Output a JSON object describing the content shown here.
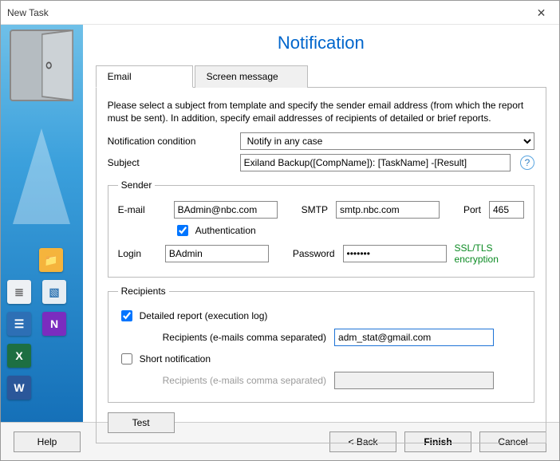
{
  "window": {
    "title": "New Task",
    "close_glyph": "✕"
  },
  "page": {
    "title": "Notification"
  },
  "tabs": {
    "email": "Email",
    "screen": "Screen message"
  },
  "desc": "Please select a subject from template and specify the sender email address (from which the report must be sent). In addition, specify email addresses of recipients of detailed or brief reports.",
  "condition": {
    "label": "Notification condition",
    "value": "Notify in any case"
  },
  "subject": {
    "label": "Subject",
    "value": "Exiland Backup([CompName]): [TaskName] -[Result]",
    "help_glyph": "?"
  },
  "sender": {
    "legend": "Sender",
    "email_label": "E-mail",
    "email_value": "BAdmin@nbc.com",
    "smtp_label": "SMTP",
    "smtp_value": "smtp.nbc.com",
    "port_label": "Port",
    "port_value": "465",
    "auth_label": "Authentication",
    "auth_checked": true,
    "login_label": "Login",
    "login_value": "BAdmin",
    "password_label": "Password",
    "password_value": "•••••••",
    "ssl_label": "SSL/TLS encryption"
  },
  "recipients": {
    "legend": "Recipients",
    "detailed_label": "Detailed report (execution log)",
    "detailed_checked": true,
    "recipients_label": "Recipients (e-mails comma separated)",
    "detailed_value": "adm_stat@gmail.com",
    "short_label": "Short notification",
    "short_checked": false,
    "short_value": ""
  },
  "buttons": {
    "test": "Test",
    "help": "Help",
    "back": "< Back",
    "finish": "Finish",
    "cancel": "Cancel"
  },
  "sidebar_icons": {
    "folder": "📁",
    "doc": "≣",
    "pic": "▧",
    "contacts": "☰",
    "onenote": "N",
    "excel": "X",
    "word": "W"
  }
}
